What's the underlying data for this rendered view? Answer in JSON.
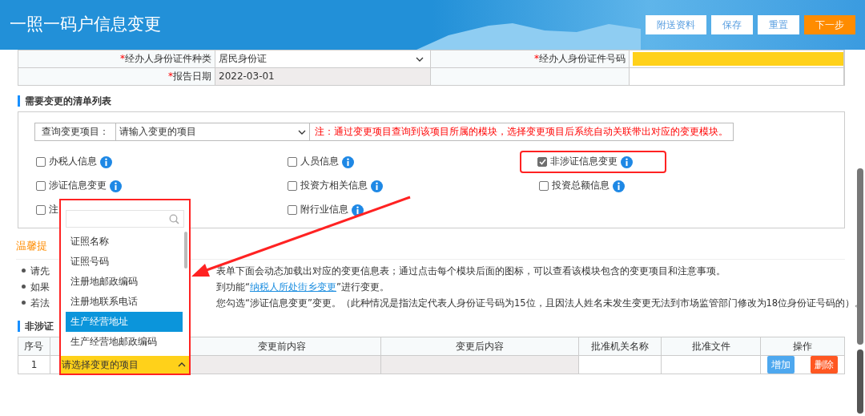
{
  "header": {
    "title": "一照一码户信息变更",
    "buttons": [
      {
        "label": "附送资料",
        "kind": "default"
      },
      {
        "label": "保存",
        "kind": "default"
      },
      {
        "label": "重置",
        "kind": "default"
      },
      {
        "label": "下一步",
        "kind": "primary"
      }
    ]
  },
  "form_rows": [
    {
      "fields": [
        {
          "mark": "*",
          "label": "经办人身份证件种类",
          "kind": "select",
          "value": "居民身份证"
        },
        {
          "mark": "*",
          "label": "经办人身份证件号码",
          "kind": "required-input"
        }
      ]
    },
    {
      "fields": [
        {
          "mark": "*",
          "label": "报告日期",
          "kind": "readonly",
          "value": "2022-03-01"
        }
      ]
    }
  ],
  "checklist": {
    "title": "需要变更的清单列表",
    "query": {
      "label": "查询变更项目：",
      "value": "请输入变更的项目"
    },
    "note": "注：通过变更项目查询到该项目所属的模块，选择变更项目后系统自动关联带出对应的变更模块。",
    "items": [
      {
        "label": "办税人信息",
        "checked": false,
        "highlighted": false
      },
      {
        "label": "人员信息",
        "checked": false,
        "highlighted": false
      },
      {
        "label": "非涉证信息变更",
        "checked": true,
        "highlighted": true
      },
      {
        "label": "涉证信息变更",
        "checked": false,
        "highlighted": false
      },
      {
        "label": "投资方相关信息",
        "checked": false,
        "highlighted": false
      },
      {
        "label": "投资总额信息",
        "checked": false,
        "highlighted": false
      },
      {
        "label": "注",
        "checked": false,
        "highlighted": false
      },
      {
        "label": "附行业信息",
        "checked": false,
        "highlighted": false
      }
    ]
  },
  "tips": {
    "title": "温馨提",
    "items": [
      {
        "left": "请先",
        "right": "表单下面会动态加载出对应的变更信息表；通过点击每个模块后面的图标，可以查看该模块包含的变更项目和注意事项。"
      },
      {
        "left": "如果",
        "right": "到功能“",
        "link": "纳税人所处街乡变更",
        "after": "”进行变更。"
      },
      {
        "left": "若法",
        "right": "您勾选“涉证信息变更”变更。（此种情况是指法定代表人身份证号码为15位，且因法人姓名未发生变更无法到市场监管部门修改为18位身份证号码的）。"
      }
    ]
  },
  "change_table": {
    "title": "非涉证",
    "columns": [
      {
        "label": "序号"
      },
      {
        "covered": true
      },
      {
        "label": "变更前内容"
      },
      {
        "label": "变更后内容"
      },
      {
        "label": "批准机关名称"
      },
      {
        "label": "批准文件"
      },
      {
        "label": "操作"
      }
    ],
    "rows": [
      {
        "number": "1",
        "actions": [
          {
            "label": "增加",
            "kind": "add"
          },
          {
            "label": "删除",
            "kind": "delete"
          }
        ]
      }
    ]
  },
  "dropdown": {
    "expanded": true,
    "highlighted": true,
    "value": "请选择变更的项目",
    "options": [
      {
        "label": "证照名称",
        "selected": false
      },
      {
        "label": "证照号码",
        "selected": false
      },
      {
        "label": "注册地邮政编码",
        "selected": false
      },
      {
        "label": "注册地联系电话",
        "selected": false
      },
      {
        "label": "生产经营地址",
        "selected": true
      },
      {
        "label": "生产经营地邮政编码",
        "selected": false
      }
    ]
  }
}
